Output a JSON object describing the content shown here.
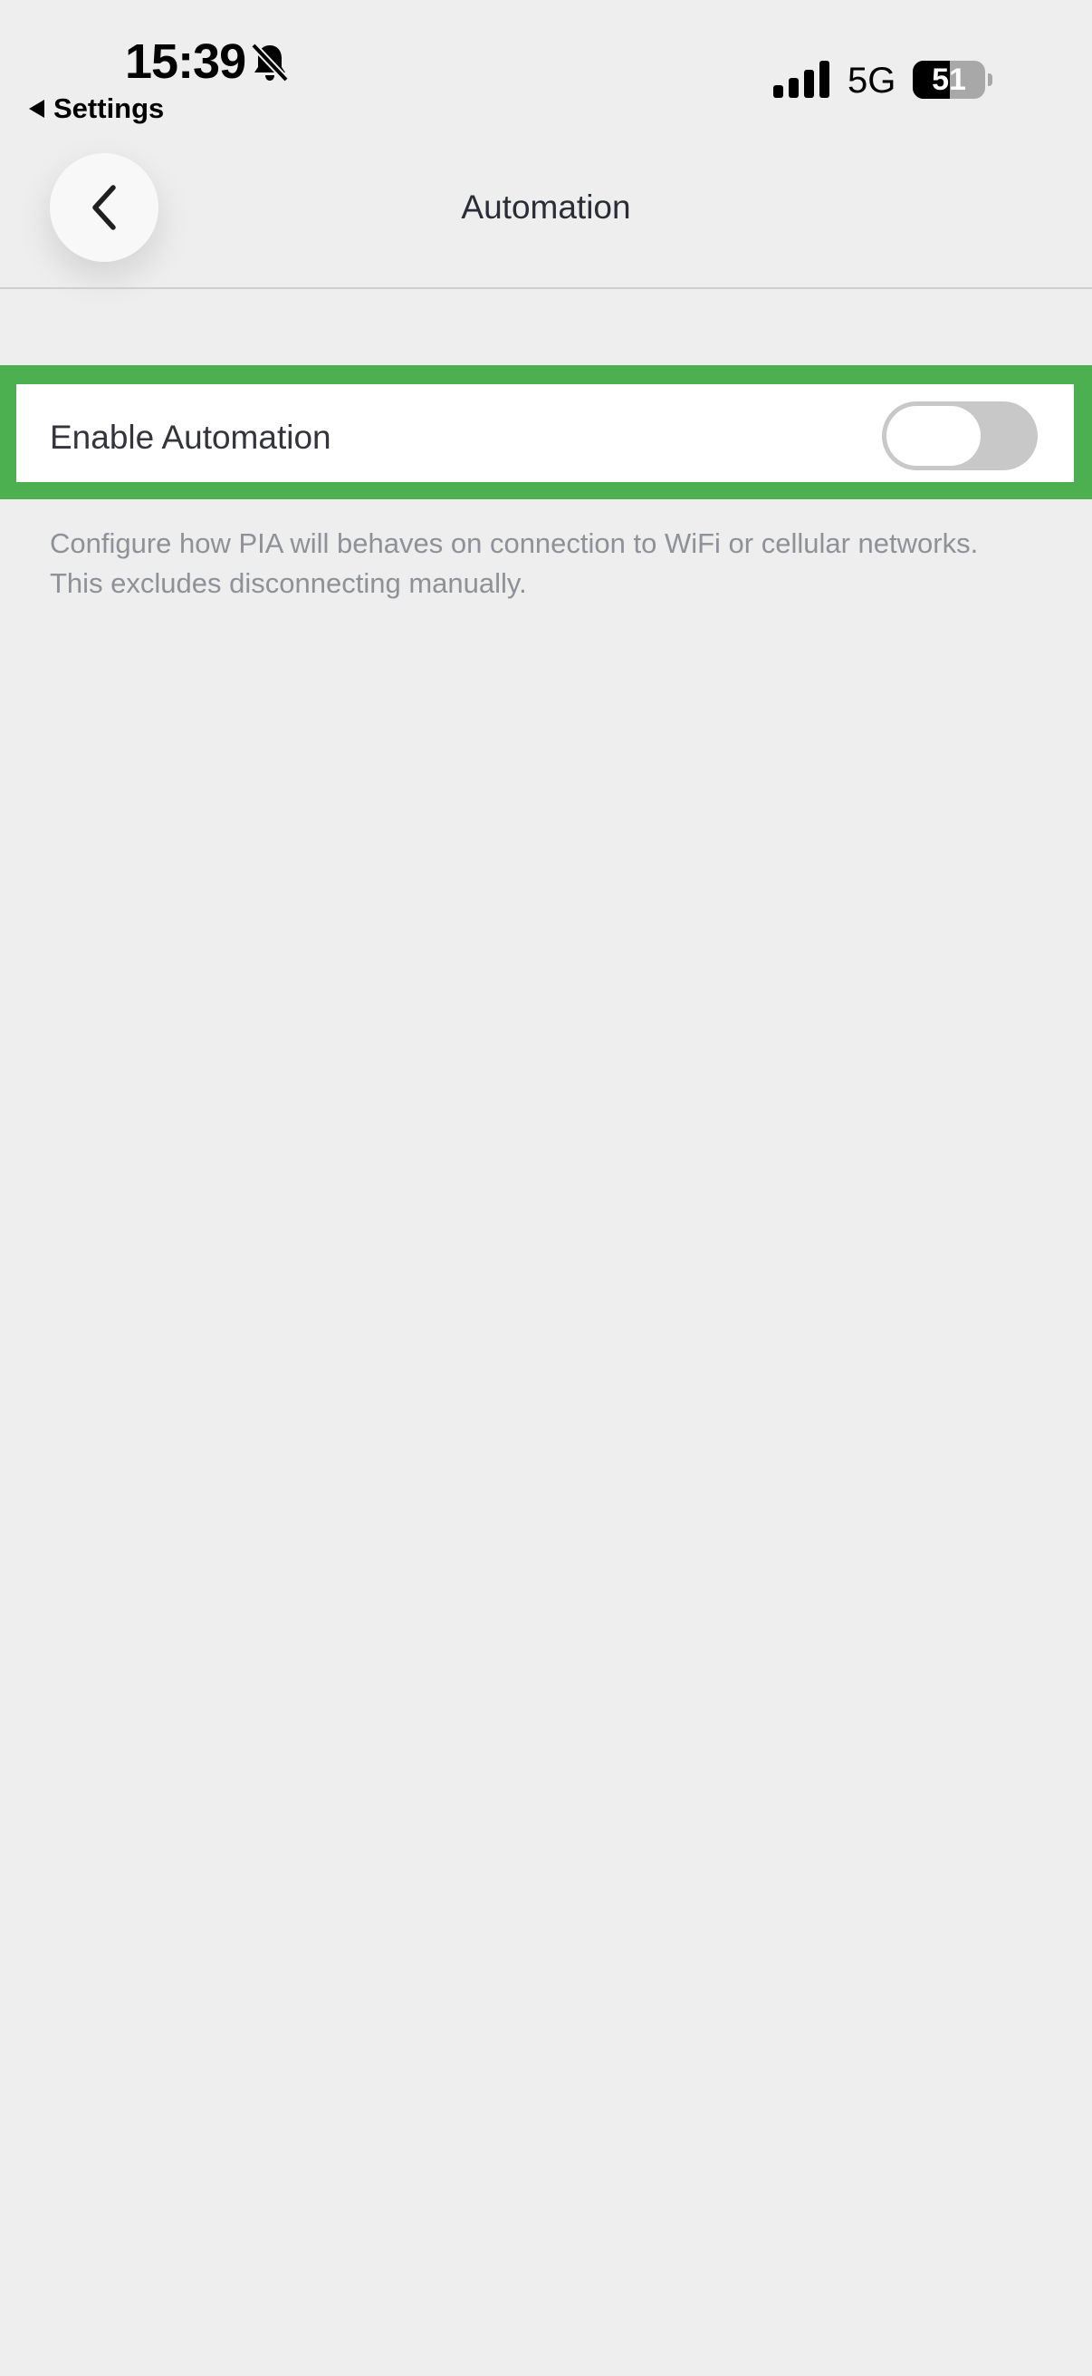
{
  "status_bar": {
    "time": "15:39",
    "back_app_label": "Settings",
    "network": "5G",
    "battery_level": "51",
    "battery_fraction": 0.51
  },
  "header": {
    "title": "Automation"
  },
  "automation_row": {
    "label": "Enable Automation",
    "enabled": false
  },
  "description": {
    "line1": "Configure how PIA will behaves on connection to WiFi or cellular networks.",
    "line2": "This excludes disconnecting manually."
  },
  "colors": {
    "highlight": "#4caf50",
    "background": "#eeeeee",
    "toggle_off": "#c8c8c8"
  }
}
